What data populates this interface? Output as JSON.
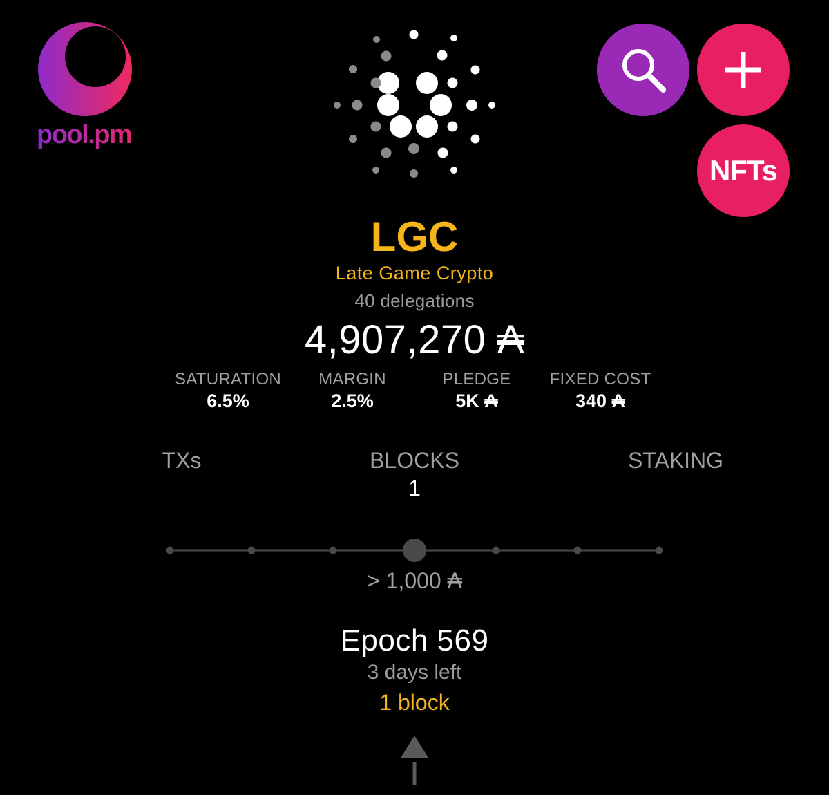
{
  "brand": {
    "logo_text": "pool.pm",
    "colors": {
      "purple": "#9a2ab6",
      "pink": "#e81f63",
      "gold": "#f4b51a"
    }
  },
  "header": {
    "search_icon": "search-icon",
    "add_icon": "plus-icon",
    "nfts_label": "NFTs"
  },
  "pool": {
    "ticker": "LGC",
    "name": "Late Game Crypto",
    "delegations": "40 delegations",
    "stake": "4,907,270",
    "currency_symbol": "₳"
  },
  "stats": {
    "saturation": {
      "label": "SATURATION",
      "value": "6.5%"
    },
    "margin": {
      "label": "MARGIN",
      "value": "2.5%"
    },
    "pledge": {
      "label": "PLEDGE",
      "value": "5K"
    },
    "fixed_cost": {
      "label": "FIXED COST",
      "value": "340"
    }
  },
  "tabs": {
    "txs": "TXs",
    "blocks": "BLOCKS",
    "staking": "STAKING",
    "blocks_count": "1"
  },
  "slider": {
    "stops": 7,
    "selected_index": 3,
    "label_prefix": "> 1,000"
  },
  "epoch": {
    "title": "Epoch 569",
    "time_left": "3 days left",
    "blocks": "1 block"
  }
}
